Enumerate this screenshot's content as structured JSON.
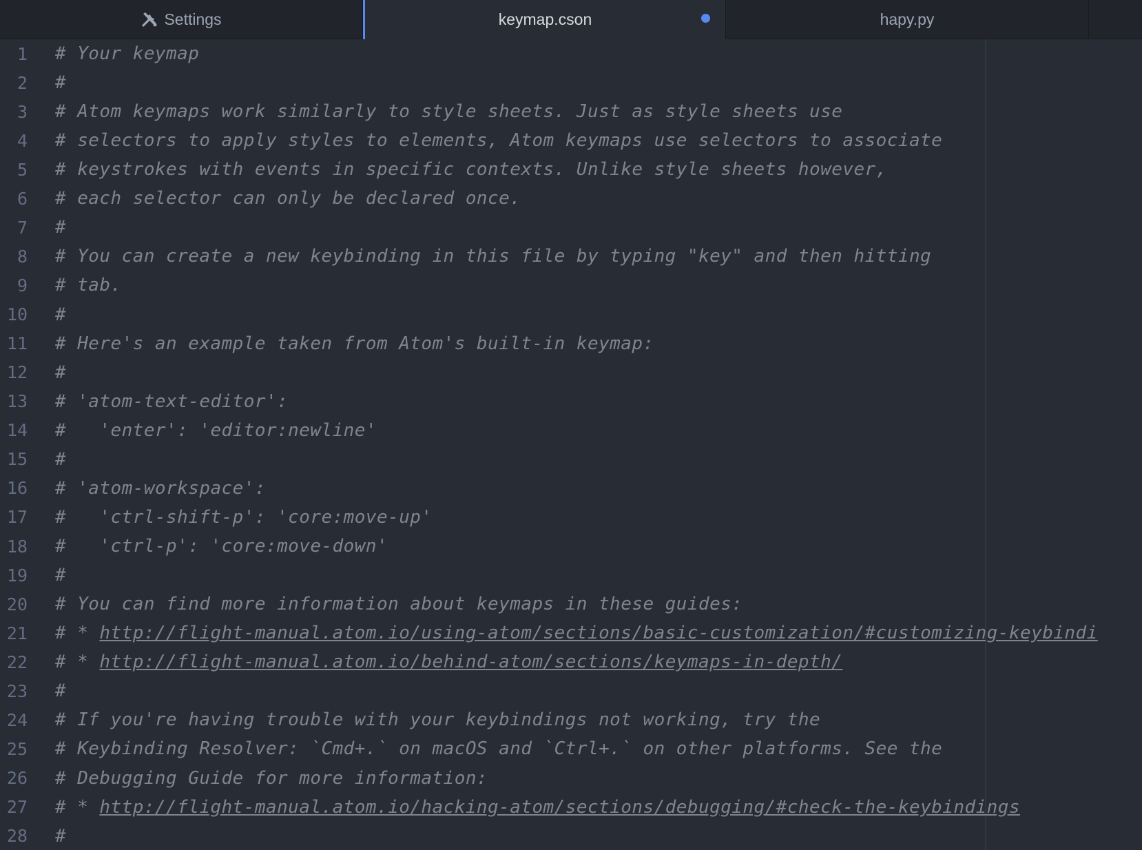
{
  "tabs": [
    {
      "label": "Settings",
      "icon": "tools-icon",
      "active": false,
      "modified": false
    },
    {
      "label": "keymap.cson",
      "active": true,
      "modified": true
    },
    {
      "label": "hapy.py",
      "active": false,
      "modified": false
    }
  ],
  "editor": {
    "lines": [
      {
        "num": "1",
        "text": "# Your keymap"
      },
      {
        "num": "2",
        "text": "#"
      },
      {
        "num": "3",
        "text": "# Atom keymaps work similarly to style sheets. Just as style sheets use"
      },
      {
        "num": "4",
        "text": "# selectors to apply styles to elements, Atom keymaps use selectors to associate"
      },
      {
        "num": "5",
        "text": "# keystrokes with events in specific contexts. Unlike style sheets however,"
      },
      {
        "num": "6",
        "text": "# each selector can only be declared once."
      },
      {
        "num": "7",
        "text": "#"
      },
      {
        "num": "8",
        "text": "# You can create a new keybinding in this file by typing \"key\" and then hitting"
      },
      {
        "num": "9",
        "text": "# tab."
      },
      {
        "num": "10",
        "text": "#"
      },
      {
        "num": "11",
        "text": "# Here's an example taken from Atom's built-in keymap:"
      },
      {
        "num": "12",
        "text": "#"
      },
      {
        "num": "13",
        "text": "# 'atom-text-editor':"
      },
      {
        "num": "14",
        "text": "#   'enter': 'editor:newline'"
      },
      {
        "num": "15",
        "text": "#"
      },
      {
        "num": "16",
        "text": "# 'atom-workspace':"
      },
      {
        "num": "17",
        "text": "#   'ctrl-shift-p': 'core:move-up'"
      },
      {
        "num": "18",
        "text": "#   'ctrl-p': 'core:move-down'"
      },
      {
        "num": "19",
        "text": "#"
      },
      {
        "num": "20",
        "text": "# You can find more information about keymaps in these guides:"
      },
      {
        "num": "21",
        "text": "# * ",
        "link": "http://flight-manual.atom.io/using-atom/sections/basic-customization/#customizing-keybindi"
      },
      {
        "num": "22",
        "text": "# * ",
        "link": "http://flight-manual.atom.io/behind-atom/sections/keymaps-in-depth/"
      },
      {
        "num": "23",
        "text": "#"
      },
      {
        "num": "24",
        "text": "# If you're having trouble with your keybindings not working, try the"
      },
      {
        "num": "25",
        "text": "# Keybinding Resolver: `Cmd+.` on macOS and `Ctrl+.` on other platforms. See the"
      },
      {
        "num": "26",
        "text": "# Debugging Guide for more information:"
      },
      {
        "num": "27",
        "text": "# * ",
        "link": "http://flight-manual.atom.io/hacking-atom/sections/debugging/#check-the-keybindings"
      },
      {
        "num": "28",
        "text": "#"
      }
    ]
  },
  "colors": {
    "accent": "#568af2",
    "comment": "#7f848e",
    "gutter": "#636d83",
    "background": "#282c34",
    "tabbar": "#21252b"
  }
}
